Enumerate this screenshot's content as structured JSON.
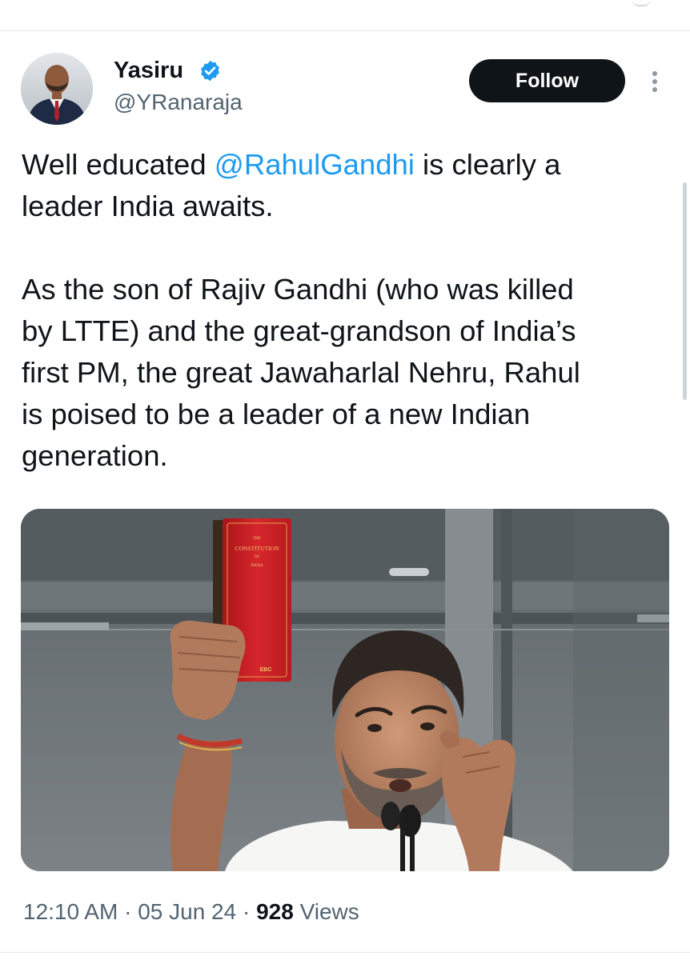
{
  "author": {
    "name": "Yasiru",
    "handle": "@YRanaraja",
    "verified": true,
    "verified_color": "#1d9bf0",
    "avatar_icon": "profile-photo"
  },
  "actions": {
    "follow_label": "Follow",
    "more_icon": "more-vertical-icon"
  },
  "tweet": {
    "line1_before": "Well educated ",
    "mention": "@RahulGandhi",
    "line1_after": " is clearly a\nleader India awaits.\n\nAs the son of Rajiv Gandhi (who was killed\nby LTTE) and the great-grandson of India’s\nfirst PM, the great Jawaharlal Nehru, Rahul\nis poised to be a leader of a new Indian\ngeneration.",
    "mention_color": "#1d9bf0"
  },
  "media": {
    "kind": "photo",
    "book_cover_line1": "CONSTITUTION",
    "book_cover_line2": "OF",
    "book_cover_line3": "INDIA",
    "book_spine_mark": "EBC"
  },
  "meta": {
    "time": "12:10 AM",
    "separator": " · ",
    "date": "05 Jun 24",
    "views_count": "928",
    "views_label": " Views"
  },
  "colors": {
    "text_primary": "#0f1419",
    "text_secondary": "#536471",
    "link": "#1d9bf0",
    "button_bg": "#0f1419",
    "divider": "#e6e9ec"
  }
}
